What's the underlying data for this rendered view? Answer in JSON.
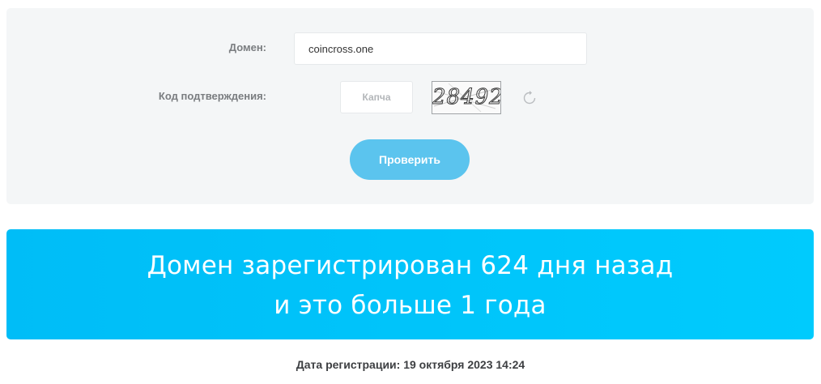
{
  "form": {
    "domain_label": "Домен:",
    "domain_value": "coincross.one",
    "code_label": "Код подтверждения:",
    "captcha_placeholder": "Капча",
    "captcha_image_text": "28492",
    "refresh_icon": "refresh-icon",
    "submit_label": "Проверить"
  },
  "result": {
    "line1": "Домен зарегистрирован 624 дня назад",
    "line2": "и это больше 1 года"
  },
  "registration": {
    "date_text": "Дата регистрации: 19 октября 2023 14:24"
  },
  "colors": {
    "panel_bg": "#f4f6f7",
    "button_bg": "#5bc4ee",
    "banner_bg": "#00c4fa",
    "label_text": "#7a7d80"
  }
}
